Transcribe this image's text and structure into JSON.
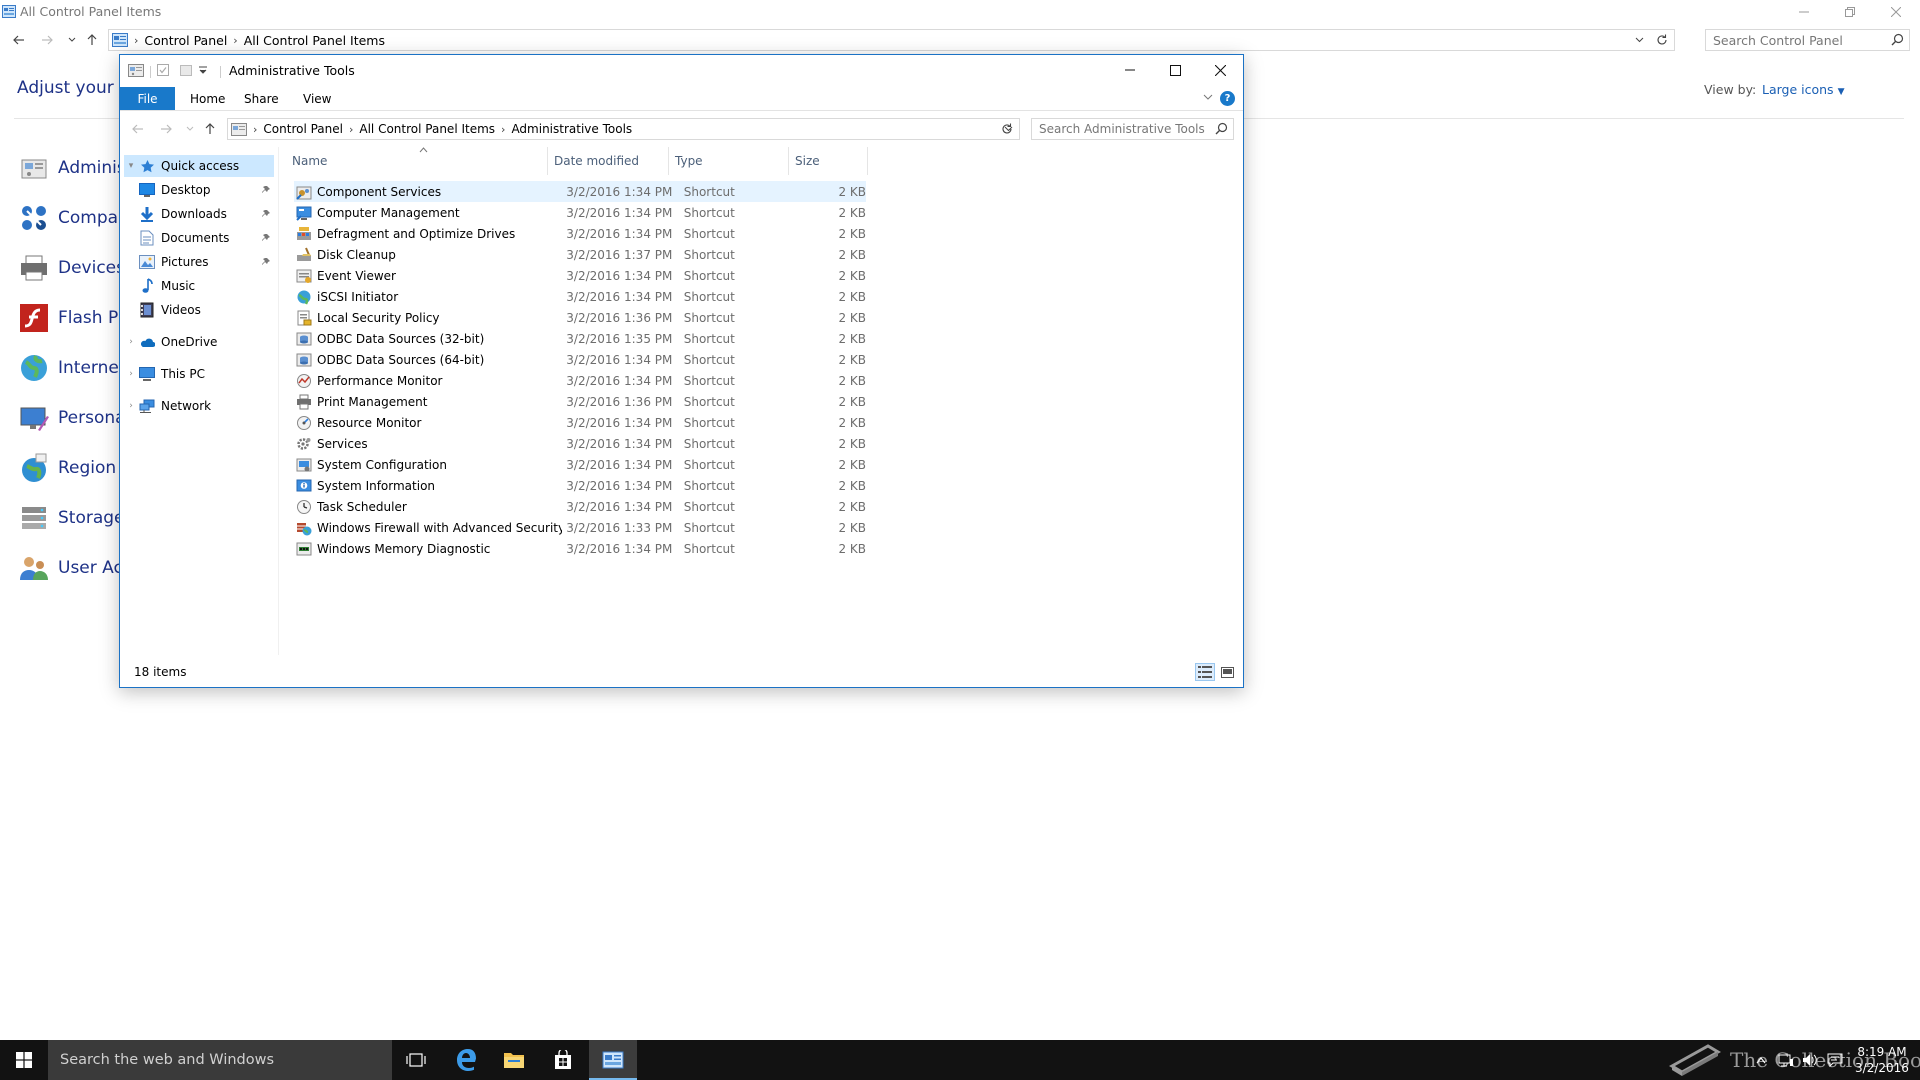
{
  "background_window": {
    "title": "All Control Panel Items",
    "breadcrumb": [
      "Control Panel",
      "All Control Panel Items"
    ],
    "search_placeholder": "Search Control Panel",
    "heading": "Adjust your co",
    "view_by_label": "View by:",
    "view_by_value": "Large icons",
    "items": [
      {
        "label": "Adminis",
        "icon": "admin-tools-icon"
      },
      {
        "label": "Compan",
        "icon": "component-icon"
      },
      {
        "label": "Devices",
        "icon": "printer-icon"
      },
      {
        "label": "Flash Pla",
        "icon": "flash-icon"
      },
      {
        "label": "Internet",
        "icon": "globe-icon"
      },
      {
        "label": "Personal",
        "icon": "personalization-icon"
      },
      {
        "label": "Region",
        "icon": "region-icon"
      },
      {
        "label": "Storage",
        "icon": "storage-icon"
      },
      {
        "label": "User Acc",
        "icon": "users-icon"
      }
    ]
  },
  "explorer": {
    "title": "Administrative Tools",
    "ribbon_tabs": [
      "File",
      "Home",
      "Share",
      "View"
    ],
    "help_label": "?",
    "breadcrumb": [
      "Control Panel",
      "All Control Panel Items",
      "Administrative Tools"
    ],
    "search_placeholder": "Search Administrative Tools",
    "nav": {
      "quick_access": "Quick access",
      "quick_items": [
        {
          "label": "Desktop",
          "icon": "desktop-icon",
          "pinned": true
        },
        {
          "label": "Downloads",
          "icon": "downloads-icon",
          "pinned": true
        },
        {
          "label": "Documents",
          "icon": "documents-icon",
          "pinned": true
        },
        {
          "label": "Pictures",
          "icon": "pictures-icon",
          "pinned": true
        },
        {
          "label": "Music",
          "icon": "music-icon",
          "pinned": false
        },
        {
          "label": "Videos",
          "icon": "videos-icon",
          "pinned": false
        }
      ],
      "roots": [
        {
          "label": "OneDrive",
          "icon": "onedrive-icon"
        },
        {
          "label": "This PC",
          "icon": "this-pc-icon"
        },
        {
          "label": "Network",
          "icon": "network-icon"
        }
      ]
    },
    "columns": {
      "name": "Name",
      "date": "Date modified",
      "type": "Type",
      "size": "Size"
    },
    "files": [
      {
        "name": "Component Services",
        "date": "3/2/2016 1:34 PM",
        "type": "Shortcut",
        "size": "2 KB"
      },
      {
        "name": "Computer Management",
        "date": "3/2/2016 1:34 PM",
        "type": "Shortcut",
        "size": "2 KB"
      },
      {
        "name": "Defragment and Optimize Drives",
        "date": "3/2/2016 1:34 PM",
        "type": "Shortcut",
        "size": "2 KB"
      },
      {
        "name": "Disk Cleanup",
        "date": "3/2/2016 1:37 PM",
        "type": "Shortcut",
        "size": "2 KB"
      },
      {
        "name": "Event Viewer",
        "date": "3/2/2016 1:34 PM",
        "type": "Shortcut",
        "size": "2 KB"
      },
      {
        "name": "iSCSI Initiator",
        "date": "3/2/2016 1:34 PM",
        "type": "Shortcut",
        "size": "2 KB"
      },
      {
        "name": "Local Security Policy",
        "date": "3/2/2016 1:36 PM",
        "type": "Shortcut",
        "size": "2 KB"
      },
      {
        "name": "ODBC Data Sources (32-bit)",
        "date": "3/2/2016 1:35 PM",
        "type": "Shortcut",
        "size": "2 KB"
      },
      {
        "name": "ODBC Data Sources (64-bit)",
        "date": "3/2/2016 1:34 PM",
        "type": "Shortcut",
        "size": "2 KB"
      },
      {
        "name": "Performance Monitor",
        "date": "3/2/2016 1:34 PM",
        "type": "Shortcut",
        "size": "2 KB"
      },
      {
        "name": "Print Management",
        "date": "3/2/2016 1:36 PM",
        "type": "Shortcut",
        "size": "2 KB"
      },
      {
        "name": "Resource Monitor",
        "date": "3/2/2016 1:34 PM",
        "type": "Shortcut",
        "size": "2 KB"
      },
      {
        "name": "Services",
        "date": "3/2/2016 1:34 PM",
        "type": "Shortcut",
        "size": "2 KB"
      },
      {
        "name": "System Configuration",
        "date": "3/2/2016 1:34 PM",
        "type": "Shortcut",
        "size": "2 KB"
      },
      {
        "name": "System Information",
        "date": "3/2/2016 1:34 PM",
        "type": "Shortcut",
        "size": "2 KB"
      },
      {
        "name": "Task Scheduler",
        "date": "3/2/2016 1:34 PM",
        "type": "Shortcut",
        "size": "2 KB"
      },
      {
        "name": "Windows Firewall with Advanced Security",
        "date": "3/2/2016 1:33 PM",
        "type": "Shortcut",
        "size": "2 KB"
      },
      {
        "name": "Windows Memory Diagnostic",
        "date": "3/2/2016 1:34 PM",
        "type": "Shortcut",
        "size": "2 KB"
      }
    ],
    "status": "18 items"
  },
  "taskbar": {
    "search_placeholder": "Search the web and Windows",
    "watermark": "The Collection Book",
    "clock_time": "8:19 AM",
    "clock_date": "3/2/2016"
  },
  "colors": {
    "accent": "#1979ca",
    "selection": "#cce8ff",
    "hover": "#e5f3ff",
    "taskbar": "#121212",
    "link": "#1e3287"
  }
}
